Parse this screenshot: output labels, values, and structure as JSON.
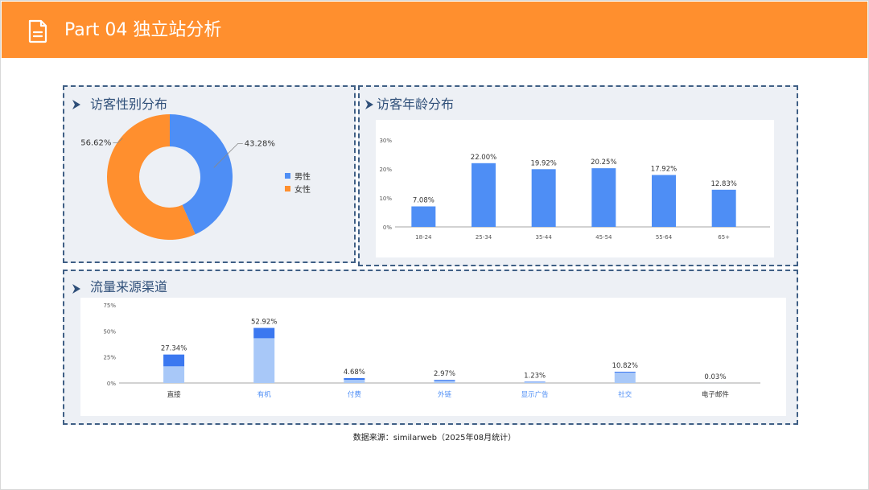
{
  "header": {
    "title": "Part 04 独立站分析"
  },
  "sections": {
    "gender": {
      "title": "访客性别分布"
    },
    "age": {
      "title": "访客年龄分布"
    },
    "traffic": {
      "title": "流量来源渠道"
    }
  },
  "footer": {
    "source": "数据来源：similarweb（2025年08月统计）"
  },
  "colors": {
    "header": "#ff8f2e",
    "blue": "#4e8ef5",
    "orange": "#ff8f2e",
    "light_blue": "#a8c8f8",
    "dark_blue": "#3b78f0",
    "panel": "#edf0f5",
    "border": "#3f5f85"
  },
  "chart_data": [
    {
      "type": "pie",
      "title": "访客性别分布",
      "categories": [
        "男性",
        "女性"
      ],
      "values": [
        43.28,
        56.62
      ],
      "labels": [
        "43.28%",
        "56.62%"
      ],
      "legend": "right"
    },
    {
      "type": "bar",
      "title": "访客年龄分布",
      "categories": [
        "18-24",
        "25-34",
        "35-44",
        "45-54",
        "55-64",
        "65+"
      ],
      "values": [
        7.08,
        22.0,
        19.92,
        20.25,
        17.92,
        12.83
      ],
      "labels": [
        "7.08%",
        "22.00%",
        "19.92%",
        "20.25%",
        "17.92%",
        "12.83%"
      ],
      "yticks": [
        "0%",
        "10%",
        "20%",
        "30%"
      ],
      "ylim": [
        0,
        30
      ],
      "grid": false
    },
    {
      "type": "bar",
      "stacked": true,
      "title": "流量来源渠道",
      "categories": [
        "直接",
        "有机",
        "付费",
        "外链",
        "显示广告",
        "社交",
        "电子邮件"
      ],
      "values": [
        27.34,
        52.92,
        4.68,
        2.97,
        1.23,
        10.82,
        0.03
      ],
      "lower_values": [
        16,
        43,
        3,
        2,
        0.8,
        10,
        0.02
      ],
      "labels": [
        "27.34%",
        "52.92%",
        "4.68%",
        "2.97%",
        "1.23%",
        "10.82%",
        "0.03%"
      ],
      "yticks": [
        "0%",
        "25%",
        "50%",
        "75%"
      ],
      "ylim": [
        0,
        75
      ],
      "grid": false
    }
  ]
}
